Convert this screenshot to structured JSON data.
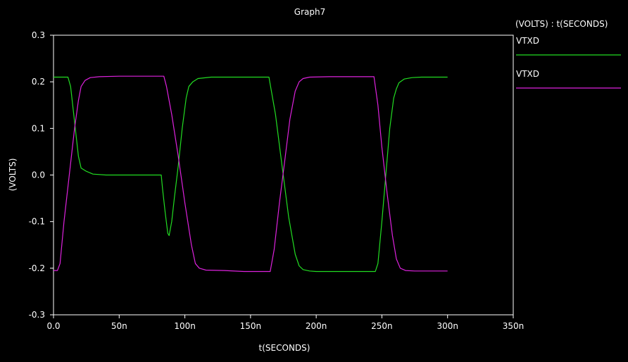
{
  "chart_data": {
    "type": "line",
    "title": "Graph7",
    "legend_header": "(VOLTS) : t(SECONDS)",
    "xlabel": "t(SECONDS)",
    "ylabel": "(VOLTS)",
    "xlim": [
      0,
      350
    ],
    "ylim": [
      -0.3,
      0.3
    ],
    "x_ticks": [
      0,
      50,
      100,
      150,
      200,
      250,
      300,
      350
    ],
    "x_tick_labels": [
      "0.0",
      "50n",
      "100n",
      "150n",
      "200n",
      "250n",
      "300n",
      "350n"
    ],
    "y_ticks": [
      0.3,
      0.2,
      0.1,
      0.0,
      -0.1,
      -0.2,
      -0.3
    ],
    "y_tick_labels": [
      "0.3",
      "0.2",
      "0.1",
      "0.0",
      "-0.1",
      "-0.2",
      "-0.3"
    ],
    "grid": false,
    "legend_position": "right",
    "series": [
      {
        "name": "VTXD",
        "color": "#22dd22",
        "points": [
          [
            0,
            0.21
          ],
          [
            11,
            0.21
          ],
          [
            13,
            0.19
          ],
          [
            15,
            0.14
          ],
          [
            17,
            0.09
          ],
          [
            19,
            0.04
          ],
          [
            21,
            0.015
          ],
          [
            25,
            0.008
          ],
          [
            30,
            0.002
          ],
          [
            40,
            0.0
          ],
          [
            60,
            0.0
          ],
          [
            82,
            0.0
          ],
          [
            83,
            -0.03
          ],
          [
            85,
            -0.08
          ],
          [
            87,
            -0.125
          ],
          [
            88,
            -0.13
          ],
          [
            90,
            -0.1
          ],
          [
            92,
            -0.05
          ],
          [
            95,
            0.02
          ],
          [
            98,
            0.1
          ],
          [
            101,
            0.165
          ],
          [
            103,
            0.19
          ],
          [
            106,
            0.2
          ],
          [
            110,
            0.207
          ],
          [
            120,
            0.21
          ],
          [
            164,
            0.21
          ],
          [
            169,
            0.13
          ],
          [
            174,
            0.02
          ],
          [
            179,
            -0.09
          ],
          [
            184,
            -0.17
          ],
          [
            187,
            -0.195
          ],
          [
            190,
            -0.203
          ],
          [
            195,
            -0.206
          ],
          [
            200,
            -0.207
          ],
          [
            245,
            -0.207
          ],
          [
            247,
            -0.19
          ],
          [
            250,
            -0.1
          ],
          [
            253,
            0.0
          ],
          [
            256,
            0.1
          ],
          [
            259,
            0.165
          ],
          [
            261,
            0.185
          ],
          [
            263,
            0.198
          ],
          [
            267,
            0.206
          ],
          [
            273,
            0.209
          ],
          [
            280,
            0.21
          ],
          [
            300,
            0.21
          ]
        ]
      },
      {
        "name": "VTXD",
        "color": "#dd22dd",
        "points": [
          [
            0,
            -0.205
          ],
          [
            3,
            -0.205
          ],
          [
            5,
            -0.19
          ],
          [
            8,
            -0.1
          ],
          [
            12,
            0.0
          ],
          [
            16,
            0.1
          ],
          [
            19,
            0.16
          ],
          [
            21,
            0.19
          ],
          [
            24,
            0.203
          ],
          [
            28,
            0.209
          ],
          [
            35,
            0.211
          ],
          [
            50,
            0.212
          ],
          [
            84,
            0.212
          ],
          [
            86,
            0.19
          ],
          [
            90,
            0.13
          ],
          [
            95,
            0.04
          ],
          [
            100,
            -0.06
          ],
          [
            105,
            -0.15
          ],
          [
            108,
            -0.19
          ],
          [
            111,
            -0.2
          ],
          [
            116,
            -0.204
          ],
          [
            130,
            -0.205
          ],
          [
            145,
            -0.207
          ],
          [
            165,
            -0.207
          ],
          [
            168,
            -0.16
          ],
          [
            172,
            -0.06
          ],
          [
            176,
            0.03
          ],
          [
            180,
            0.12
          ],
          [
            184,
            0.18
          ],
          [
            187,
            0.2
          ],
          [
            190,
            0.207
          ],
          [
            195,
            0.21
          ],
          [
            210,
            0.211
          ],
          [
            244,
            0.211
          ],
          [
            247,
            0.15
          ],
          [
            250,
            0.06
          ],
          [
            254,
            -0.04
          ],
          [
            258,
            -0.13
          ],
          [
            261,
            -0.18
          ],
          [
            264,
            -0.2
          ],
          [
            268,
            -0.205
          ],
          [
            275,
            -0.206
          ],
          [
            300,
            -0.206
          ]
        ]
      }
    ]
  }
}
